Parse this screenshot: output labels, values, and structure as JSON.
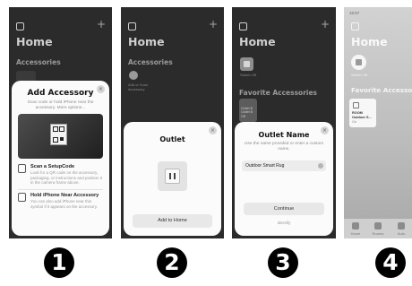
{
  "steps": [
    "1",
    "2",
    "3",
    "4"
  ],
  "panel1": {
    "title": "Home",
    "section": "Accessories",
    "sheet_title": "Add Accessory",
    "sheet_subtitle": "Scan code or hold iPhone near the accessory. More options...",
    "option1_title": "Scan a SetupCode",
    "option1_desc": "Look for a QR code on the accessory, packaging, or instructions and position it in the camera frame above.",
    "option2_title": "Hold iPhone Near Accessory",
    "option2_desc": "You can also add iPhone near this symbol if it appears on the accessory."
  },
  "panel2": {
    "title": "Home",
    "section": "Accessories",
    "add_tile_label": "Add or Scan Accessory",
    "sheet_title": "Outlet",
    "button": "Add to Home"
  },
  "panel3": {
    "title": "Home",
    "tile_label": "Switch Off",
    "section": "Favorite Accessories",
    "fav_tile_label": "Outlet B Outlet B Off",
    "sheet_title": "Outlet Name",
    "sheet_subtitle": "Use the name provided or enter a custom name.",
    "input_value": "Outdoor Smart Rug",
    "button": "Continue",
    "footer": "Identify"
  },
  "panel4": {
    "status_time": "16:57",
    "title": "Home",
    "tile_label": "Switch Off",
    "section": "Favorite Accessories",
    "fav_tile_name": "ROOM Outdoor S...",
    "fav_tile_state": "On",
    "tabs": [
      "Home",
      "Rooms",
      "Auto"
    ]
  }
}
